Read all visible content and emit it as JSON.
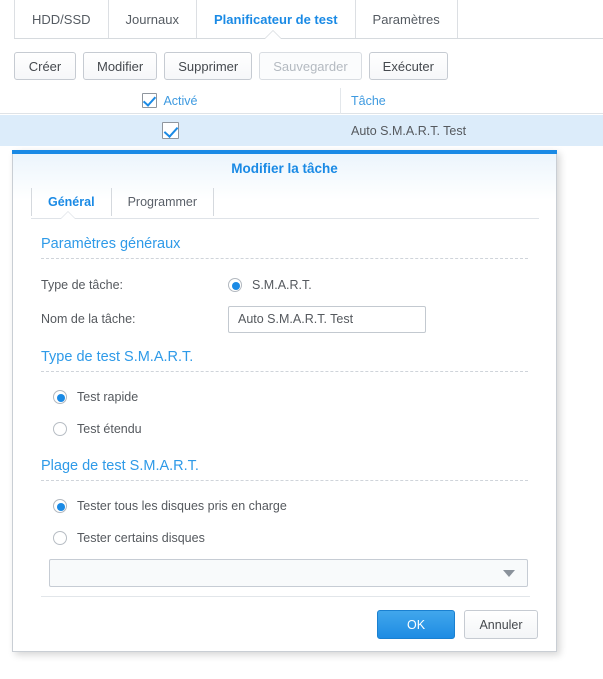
{
  "top_tabs": [
    {
      "label": "HDD/SSD",
      "active": false
    },
    {
      "label": "Journaux",
      "active": false
    },
    {
      "label": "Planificateur de test",
      "active": true
    },
    {
      "label": "Paramètres",
      "active": false
    }
  ],
  "toolbar": {
    "create_label": "Créer",
    "edit_label": "Modifier",
    "delete_label": "Supprimer",
    "save_label": "Sauvegarder",
    "run_label": "Exécuter"
  },
  "grid": {
    "columns": {
      "enabled": "Activé",
      "task": "Tâche"
    },
    "header_checkbox_checked": true,
    "rows": [
      {
        "enabled": true,
        "task": "Auto S.M.A.R.T. Test"
      }
    ]
  },
  "dialog": {
    "title": "Modifier la tâche",
    "tabs": [
      {
        "label": "Général",
        "active": true
      },
      {
        "label": "Programmer",
        "active": false
      }
    ],
    "general_section": {
      "heading": "Paramètres généraux",
      "task_type_label": "Type de tâche:",
      "task_type_value": "S.M.A.R.T.",
      "task_type_selected": true,
      "task_name_label": "Nom de la tâche:",
      "task_name_value": "Auto S.M.A.R.T. Test"
    },
    "test_type_section": {
      "heading": "Type de test S.M.A.R.T.",
      "options": [
        {
          "label": "Test rapide",
          "selected": true
        },
        {
          "label": "Test étendu",
          "selected": false
        }
      ]
    },
    "test_range_section": {
      "heading": "Plage de test S.M.A.R.T.",
      "options": [
        {
          "label": "Tester tous les disques pris en charge",
          "selected": true
        },
        {
          "label": "Tester certains disques",
          "selected": false
        }
      ],
      "disk_select_value": ""
    },
    "footer": {
      "ok_label": "OK",
      "cancel_label": "Annuler"
    }
  },
  "colors": {
    "accent": "#1a8ae5",
    "section_heading": "#2e9ae8",
    "row_highlight": "#dcecfa",
    "text": "#55595e",
    "disabled_text": "#b4bac1"
  }
}
